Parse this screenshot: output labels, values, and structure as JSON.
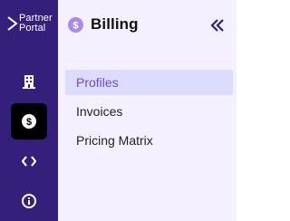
{
  "brand": {
    "line1": "Partner",
    "line2": "Portal",
    "logo_icon": "chevron-right-logo-icon"
  },
  "rail": {
    "items": [
      {
        "name": "building-icon",
        "active": false
      },
      {
        "name": "billing-dollar-icon",
        "active": true
      },
      {
        "name": "code-icon",
        "active": false
      },
      {
        "name": "info-icon",
        "active": false
      }
    ]
  },
  "panel": {
    "title": "Billing",
    "title_icon": "dollar-circle-icon",
    "collapse_icon": "double-chevron-left-icon",
    "menu": [
      {
        "label": "Profiles",
        "active": true
      },
      {
        "label": "Invoices",
        "active": false
      },
      {
        "label": "Pricing Matrix",
        "active": false
      }
    ]
  },
  "colors": {
    "rail_bg": "#34207a",
    "panel_bg": "#f4f0ff",
    "active_item_bg": "#dcdcff",
    "active_item_text": "#6f4ad8",
    "badge": "#a98ce8"
  }
}
